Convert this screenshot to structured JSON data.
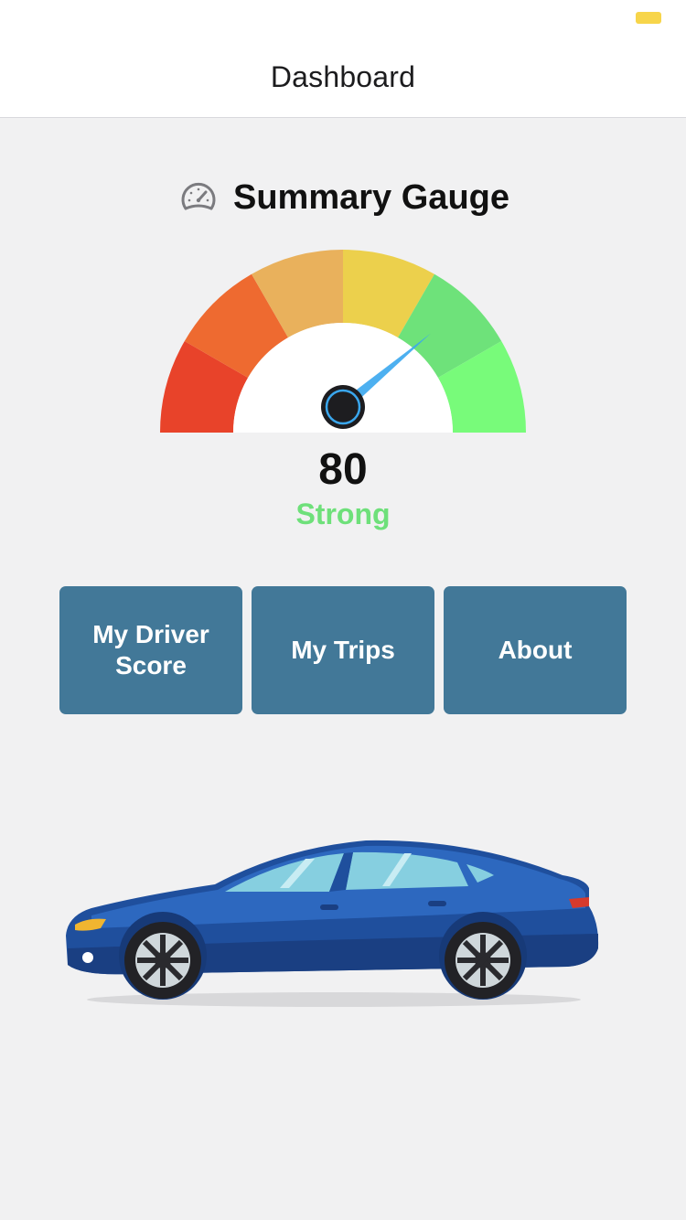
{
  "status_bar": {
    "battery_color": "#f7d54a"
  },
  "nav": {
    "title": "Dashboard"
  },
  "gauge": {
    "icon": "speedometer-icon",
    "title": "Summary Gauge",
    "value": "80",
    "status": "Strong",
    "score_fraction": 0.8,
    "status_color": "#6ee07a",
    "segment_colors": [
      "#e8432a",
      "#ee6a30",
      "#e9b15c",
      "#ecd04c",
      "#6ee27a",
      "#78fb7a"
    ],
    "needle_color": "#3aa7ee"
  },
  "menu": {
    "items": [
      {
        "label": "My Driver Score"
      },
      {
        "label": "My Trips"
      },
      {
        "label": "About"
      }
    ],
    "button_color": "#427898"
  },
  "illustration": {
    "icon": "car-icon",
    "body_color": "#1f4f9d"
  }
}
